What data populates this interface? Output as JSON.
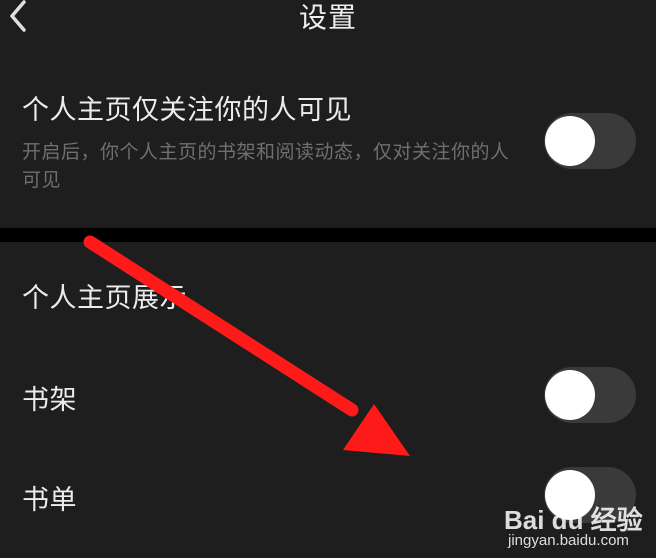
{
  "header": {
    "title": "设置",
    "back_icon": "chevron-left-icon"
  },
  "privacy_setting": {
    "title": "个人主页仅关注你的人可见",
    "description": "开启后，你个人主页的书架和阅读动态，仅对关注你的人可见",
    "enabled": false
  },
  "profile_display": {
    "section_title": "个人主页展示",
    "items": [
      {
        "label": "书架",
        "enabled": false
      },
      {
        "label": "书单",
        "enabled": false
      }
    ]
  },
  "annotation": {
    "arrow_color": "#ff1a1a",
    "arrow_icon": "red-arrow"
  },
  "watermark": {
    "logo": "Bai du 经验",
    "url": "jingyan.baidu.com"
  },
  "colors": {
    "background": "#1e1e1e",
    "divider": "#000000",
    "toggle_track": "#3a3a3a",
    "toggle_knob": "#ffffff",
    "secondary_text": "#6f6f6f"
  }
}
